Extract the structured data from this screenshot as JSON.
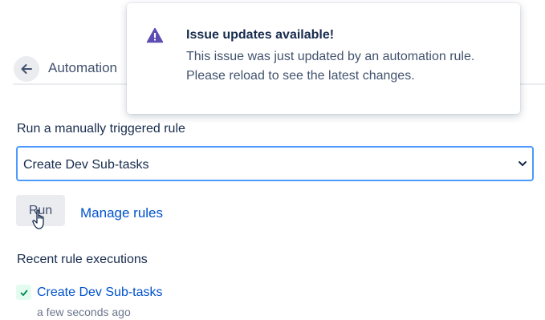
{
  "header": {
    "back_icon": "arrow-left-icon",
    "title": "Automation"
  },
  "manual_rule": {
    "label": "Run a manually triggered rule",
    "selected_rule": "Create Dev Sub-tasks",
    "run_label": "Run",
    "manage_label": "Manage rules"
  },
  "recent": {
    "label": "Recent rule executions",
    "items": [
      {
        "name": "Create Dev Sub-tasks",
        "time": "a few seconds ago",
        "status": "success"
      }
    ]
  },
  "flag": {
    "icon": "warning-icon",
    "title": "Issue updates available!",
    "body": "This issue was just updated by an automation rule. Please reload to see the latest changes."
  },
  "colors": {
    "link": "#0052cc",
    "focus_border": "#4c9aff",
    "warning": "#5e4db2",
    "success": "#00875a"
  }
}
